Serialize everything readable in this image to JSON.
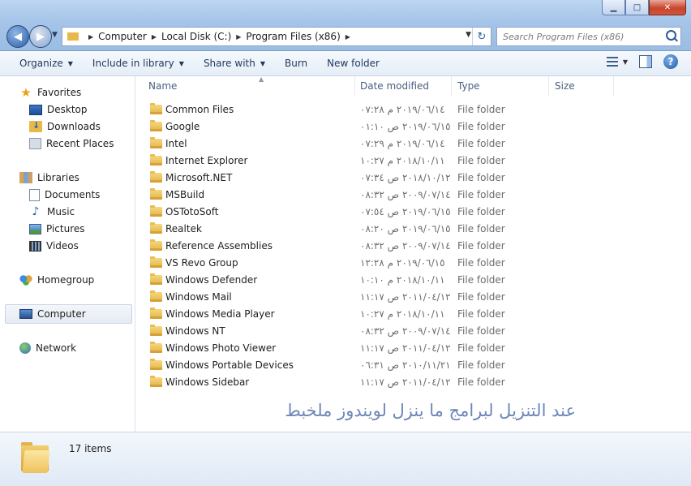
{
  "window": {
    "minimize": "▁",
    "maximize": "□",
    "close": "✕"
  },
  "nav": {
    "back": "◀",
    "forward": "▶"
  },
  "address": {
    "crumbs": [
      "Computer",
      "Local Disk (C:)",
      "Program Files (x86)"
    ]
  },
  "search": {
    "placeholder": "Search Program Files (x86)"
  },
  "toolbar": {
    "organize": "Organize",
    "include": "Include in library",
    "share": "Share with",
    "burn": "Burn",
    "new_folder": "New folder",
    "help": "?"
  },
  "sidebar": {
    "favorites": "Favorites",
    "desktop": "Desktop",
    "downloads": "Downloads",
    "recent": "Recent Places",
    "libraries": "Libraries",
    "documents": "Documents",
    "music": "Music",
    "pictures": "Pictures",
    "videos": "Videos",
    "homegroup": "Homegroup",
    "computer": "Computer",
    "network": "Network"
  },
  "columns": {
    "name": "Name",
    "date": "Date modified",
    "type": "Type",
    "size": "Size"
  },
  "files": [
    {
      "name": "Common Files",
      "date": "٢٠١٩/٠٦/١٤ م ٠٧:٢٨",
      "type": "File folder"
    },
    {
      "name": "Google",
      "date": "٢٠١٩/٠٦/١٥ ص ٠١:١٠",
      "type": "File folder"
    },
    {
      "name": "Intel",
      "date": "٢٠١٩/٠٦/١٤ م ٠٧:٢٩",
      "type": "File folder"
    },
    {
      "name": "Internet Explorer",
      "date": "٢٠١٨/١٠/١١ م ١٠:٢٧",
      "type": "File folder"
    },
    {
      "name": "Microsoft.NET",
      "date": "٢٠١٨/١٠/١٢ ص ٠٧:٣٤",
      "type": "File folder"
    },
    {
      "name": "MSBuild",
      "date": "٢٠٠٩/٠٧/١٤ ص ٠٨:٣٢",
      "type": "File folder"
    },
    {
      "name": "OSTotoSoft",
      "date": "٢٠١٩/٠٦/١٥ ص ٠٧:٥٤",
      "type": "File folder"
    },
    {
      "name": "Realtek",
      "date": "٢٠١٩/٠٦/١٥ ص ٠٨:٢٠",
      "type": "File folder"
    },
    {
      "name": "Reference Assemblies",
      "date": "٢٠٠٩/٠٧/١٤ ص ٠٨:٣٢",
      "type": "File folder"
    },
    {
      "name": "VS Revo Group",
      "date": "٢٠١٩/٠٦/١٥ م ١٢:٢٨",
      "type": "File folder"
    },
    {
      "name": "Windows Defender",
      "date": "٢٠١٨/١٠/١١ م ١٠:١٠",
      "type": "File folder"
    },
    {
      "name": "Windows Mail",
      "date": "٢٠١١/٠٤/١٢ ص ١١:١٧",
      "type": "File folder"
    },
    {
      "name": "Windows Media Player",
      "date": "٢٠١٨/١٠/١١ م ١٠:٢٧",
      "type": "File folder"
    },
    {
      "name": "Windows NT",
      "date": "٢٠٠٩/٠٧/١٤ ص ٠٨:٣٢",
      "type": "File folder"
    },
    {
      "name": "Windows Photo Viewer",
      "date": "٢٠١١/٠٤/١٢ ص ١١:١٧",
      "type": "File folder"
    },
    {
      "name": "Windows Portable Devices",
      "date": "٢٠١٠/١١/٢١ ص ٠٦:٣١",
      "type": "File folder"
    },
    {
      "name": "Windows Sidebar",
      "date": "٢٠١١/٠٤/١٢ ص ١١:١٧",
      "type": "File folder"
    }
  ],
  "watermark": "عند التنزيل لبرامج ما ينزل لويندوز ملخبط",
  "status": {
    "count": "17 items"
  }
}
